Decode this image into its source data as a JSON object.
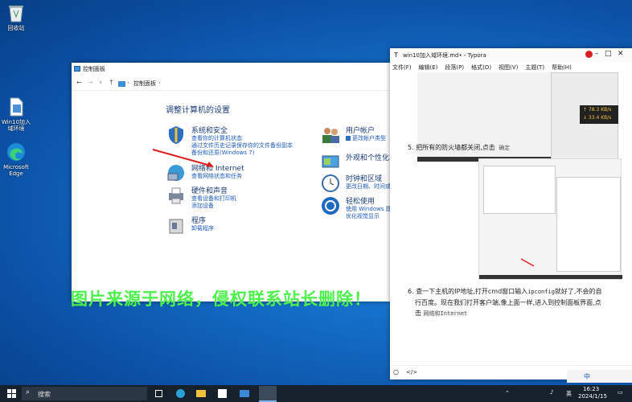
{
  "desktop": {
    "icons": [
      {
        "label": "回收站",
        "icon": "recycle-bin-icon"
      },
      {
        "label": "Win10加入域环境",
        "icon": "document-icon"
      },
      {
        "label": "Microsoft Edge",
        "icon": "edge-icon"
      }
    ]
  },
  "control_panel": {
    "title": "控制面板",
    "address": "控制面板",
    "heading": "调整计算机的设置",
    "categories": [
      {
        "title": "系统和安全",
        "links": [
          "查看你的计算机状态",
          "通过文件历史记录保存你的文件备份副本",
          "备份和还原(Windows 7)"
        ]
      },
      {
        "title": "网络和 Internet",
        "links": [
          "查看网络状态和任务"
        ]
      },
      {
        "title": "硬件和声音",
        "links": [
          "查看设备和打印机",
          "添加设备"
        ]
      },
      {
        "title": "程序",
        "links": [
          "卸载程序"
        ]
      },
      {
        "title": "用户帐户",
        "links": [
          "更改帐户类型"
        ]
      },
      {
        "title": "外观和个性化",
        "links": []
      },
      {
        "title": "时钟和区域",
        "links": [
          "更改日期、时间或"
        ]
      },
      {
        "title": "轻松使用",
        "links": [
          "使用 Windows 建",
          "优化视觉显示"
        ]
      }
    ]
  },
  "typora": {
    "title": "win10加入域环境.md• - Typora",
    "menu": [
      "文件(F)",
      "编辑(E)",
      "段落(P)",
      "格式(O)",
      "视图(V)",
      "主题(T)",
      "帮助(H)"
    ],
    "speed_up": "↑ 78.3 KB/s",
    "speed_down": "↓ 33.4 KB/s",
    "step5_num": "5.",
    "step5_text": "把所有的防火墙都关闭,点击",
    "step5_code": "确定",
    "step6_num": "6.",
    "step6_line1": "查一下主机的IP地址,打开cmd窗口输入",
    "step6_code": "ipconfig",
    "step6_line1b": "就好了,不会的自",
    "step6_line2": "行百度。现在我们打开客户端,像上面一样,进入到控制面板界面,点",
    "step6_line3": "击",
    "step6_code2": "网络和",
    "step6_code3": "Internet",
    "footer_left": "○",
    "footer_code": "</>"
  },
  "watermark": "图片来源于网络，侵权联系站长删除！",
  "taskbar": {
    "search": "搜索",
    "ime": "中",
    "time": "16:23",
    "date": "2024/1/15",
    "lang": "英"
  }
}
